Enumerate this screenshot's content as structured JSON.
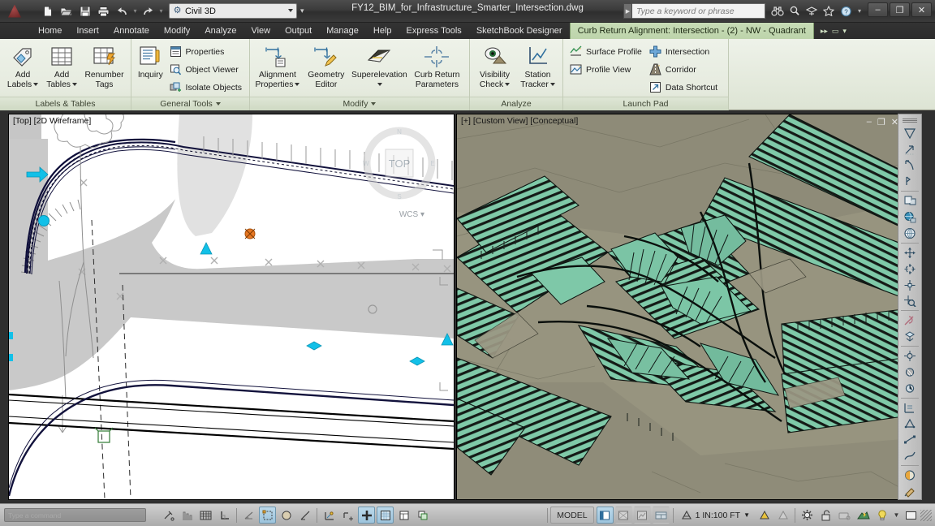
{
  "window": {
    "document_title": "FY12_BIM_for_Infrastructure_Smarter_Intersection.dwg",
    "minimize_label": "–",
    "restore_label": "❐",
    "close_label": "✕"
  },
  "quick_access": {
    "workspace_value": "Civil 3D",
    "items": [
      {
        "name": "new-icon",
        "glyph": "🗋"
      },
      {
        "name": "open-icon",
        "glyph": "📂"
      },
      {
        "name": "save-icon",
        "glyph": "💾"
      },
      {
        "name": "print-icon",
        "glyph": "🖨"
      },
      {
        "name": "undo-icon",
        "glyph": "↶"
      },
      {
        "name": "redo-icon",
        "glyph": "↷"
      }
    ]
  },
  "infocenter": {
    "search_placeholder": "Type a keyword or phrase",
    "icons": [
      {
        "name": "search-binoculars-icon",
        "glyph": "🔭"
      },
      {
        "name": "search-magnifier-icon",
        "glyph": "🔍"
      },
      {
        "name": "subscription-center-icon",
        "glyph": "☂"
      },
      {
        "name": "favorites-star-icon",
        "glyph": "☆"
      },
      {
        "name": "help-icon",
        "glyph": "?"
      }
    ]
  },
  "tabs": {
    "items": [
      "Home",
      "Insert",
      "Annotate",
      "Modify",
      "Analyze",
      "View",
      "Output",
      "Manage",
      "Help",
      "Express Tools",
      "SketchBook Designer"
    ],
    "contextual": "Curb Return Alignment: Intersection - (2) - NW - Quadrant",
    "extras": [
      {
        "name": "ribbon-expand-icon",
        "glyph": "▸▸"
      },
      {
        "name": "ribbon-display-options-icon",
        "glyph": "▭"
      },
      {
        "name": "ribbon-options-caret-icon",
        "glyph": "▾"
      }
    ]
  },
  "ribbon": {
    "panels": [
      {
        "title": "Labels & Tables",
        "has_dropdown": false,
        "big_buttons": [
          {
            "line1": "Add",
            "line2": "Labels",
            "icon": "add-labels-icon",
            "split": true
          },
          {
            "line1": "Add",
            "line2": "Tables",
            "icon": "add-tables-icon",
            "split": true
          },
          {
            "line1": "Renumber",
            "line2": "Tags",
            "icon": "renumber-tags-icon",
            "split": false
          }
        ],
        "small_buttons": []
      },
      {
        "title": "General Tools",
        "has_dropdown": true,
        "big_buttons": [
          {
            "line1": "Inquiry",
            "line2": "",
            "icon": "inquiry-icon",
            "split": false
          }
        ],
        "small_buttons": [
          {
            "label": "Properties",
            "icon": "properties-icon"
          },
          {
            "label": "Object Viewer",
            "icon": "object-viewer-icon"
          },
          {
            "label": "Isolate Objects",
            "icon": "isolate-objects-icon"
          }
        ]
      },
      {
        "title": "Modify",
        "has_dropdown": true,
        "big_buttons": [
          {
            "line1": "Alignment",
            "line2": "Properties",
            "icon": "alignment-properties-icon",
            "split": true
          },
          {
            "line1": "Geometry",
            "line2": "Editor",
            "icon": "geometry-editor-icon",
            "split": false
          },
          {
            "line1": "Superelevation",
            "line2": "",
            "icon": "superelevation-icon",
            "split": true
          },
          {
            "line1": "Curb Return",
            "line2": "Parameters",
            "icon": "curb-return-parameters-icon",
            "split": false
          }
        ],
        "small_buttons": []
      },
      {
        "title": "Analyze",
        "has_dropdown": false,
        "big_buttons": [
          {
            "line1": "Visibility",
            "line2": "Check",
            "icon": "visibility-check-icon",
            "split": true
          },
          {
            "line1": "Station",
            "line2": "Tracker",
            "icon": "station-tracker-icon",
            "split": true
          }
        ],
        "small_buttons": []
      },
      {
        "title": "Launch Pad",
        "has_dropdown": false,
        "big_buttons": [],
        "small_buttons_col1": [
          {
            "label": "Surface Profile",
            "icon": "surface-profile-icon"
          },
          {
            "label": "Profile View",
            "icon": "profile-view-icon"
          }
        ],
        "small_buttons_col2": [
          {
            "label": "Intersection",
            "icon": "intersection-icon"
          },
          {
            "label": "Corridor",
            "icon": "corridor-icon"
          },
          {
            "label": "Data Shortcut",
            "icon": "data-shortcut-icon"
          }
        ]
      }
    ]
  },
  "viewports": {
    "left": {
      "label": "[Top] [2D Wireframe]",
      "ucs_label": "WCS",
      "background": "#ffffff",
      "surface_fill": "#c4c4c4",
      "marker_color": "#12c0e8",
      "point_marker_color": "#e87722"
    },
    "right": {
      "label": "[+] [Custom View] [Conceptual]",
      "background": "#8b8a77",
      "corridor_color": "#73c6a6",
      "terrain_color": "#97947f",
      "controls": [
        {
          "name": "viewport-minimize-icon",
          "glyph": "–"
        },
        {
          "name": "viewport-maximize-icon",
          "glyph": "❐"
        },
        {
          "name": "viewport-close-icon",
          "glyph": "✕"
        }
      ]
    }
  },
  "navbar": {
    "icons": [
      {
        "name": "steering-wheel-icon",
        "glyph": "⬟"
      },
      {
        "name": "pan-icon",
        "glyph": "✥"
      },
      {
        "name": "zoom-extents-icon",
        "glyph": "⌕"
      },
      {
        "name": "orbit-icon",
        "glyph": "↻"
      },
      {
        "name": "show-motion-icon",
        "glyph": "▶"
      },
      {
        "name": "geographic-location-icon",
        "glyph": "🌐"
      },
      {
        "name": "view-globe-icon",
        "glyph": "◔"
      },
      {
        "name": "move-gizmo-icon",
        "glyph": "✣"
      },
      {
        "name": "rotate-gizmo-icon",
        "glyph": "✦"
      },
      {
        "name": "scale-gizmo-icon",
        "glyph": "✧"
      },
      {
        "name": "magnifier-icon",
        "glyph": "🔍"
      },
      {
        "name": "measure-icon",
        "glyph": "↗"
      },
      {
        "name": "section-plane-icon",
        "glyph": "◱"
      },
      {
        "name": "object-snap-icon",
        "glyph": "⊙"
      },
      {
        "name": "transparency-icon",
        "glyph": "▦"
      },
      {
        "name": "rotate-view-icon",
        "glyph": "↺"
      },
      {
        "name": "add-point-icon",
        "glyph": "⊕"
      },
      {
        "name": "array-icon",
        "glyph": "⊞"
      },
      {
        "name": "dimension-icon",
        "glyph": "⊥"
      },
      {
        "name": "align-icon",
        "glyph": "⨍"
      },
      {
        "name": "spline-icon",
        "glyph": "∿"
      },
      {
        "name": "curve-icon",
        "glyph": "⌒"
      },
      {
        "name": "render-icon",
        "glyph": "◑"
      },
      {
        "name": "material-icon",
        "glyph": "◕"
      }
    ]
  },
  "command_line": {
    "text": "Type a command"
  },
  "statusbar": {
    "left_toggles": [
      {
        "name": "snap-mode-toggle",
        "glyph": "⋅⋅",
        "state": "on"
      },
      {
        "name": "grid-display-toggle",
        "glyph": "⌗",
        "state": "off"
      },
      {
        "name": "grid-mode-toggle",
        "glyph": "▦",
        "state": "off"
      },
      {
        "name": "ortho-mode-toggle",
        "glyph": "∟",
        "state": "off"
      },
      {
        "name": "polar-tracking-toggle",
        "glyph": "∡",
        "state": "off"
      },
      {
        "name": "object-snap-toggle",
        "glyph": "◱",
        "state": "on"
      },
      {
        "name": "3d-object-snap-toggle",
        "glyph": "◍",
        "state": "off"
      },
      {
        "name": "object-snap-tracking-toggle",
        "glyph": "∠",
        "state": "off"
      },
      {
        "name": "dynamic-ucs-toggle",
        "glyph": "⊿",
        "state": "off"
      },
      {
        "name": "dynamic-input-toggle",
        "glyph": "+",
        "state": "off"
      },
      {
        "name": "lineweight-toggle",
        "glyph": "➕",
        "state": "on"
      },
      {
        "name": "transparency-toggle",
        "glyph": "▒",
        "state": "on"
      },
      {
        "name": "quick-properties-toggle",
        "glyph": "▤",
        "state": "off"
      },
      {
        "name": "selection-cycling-toggle",
        "glyph": "⧉",
        "state": "off"
      }
    ],
    "model_label": "MODEL",
    "layout_buttons": [
      {
        "name": "model-space-button",
        "glyph": "◰",
        "state": "on"
      },
      {
        "name": "quick-view-layouts-button",
        "glyph": "▧",
        "state": "off"
      },
      {
        "name": "quick-view-drawings-button",
        "glyph": "▨",
        "state": "off"
      },
      {
        "name": "pan-zoom-button",
        "glyph": "▥",
        "state": "off"
      }
    ],
    "annotation_scale": "1 IN:100 FT",
    "scale_icons": [
      {
        "name": "annotation-visibility-icon",
        "glyph": "△"
      },
      {
        "name": "auto-scale-icon",
        "glyph": "△"
      }
    ],
    "right_icons": [
      {
        "name": "workspace-switching-icon",
        "glyph": "⚙"
      },
      {
        "name": "toolbar-lock-icon",
        "glyph": "🔓"
      },
      {
        "name": "hardware-acceleration-icon",
        "glyph": "▭"
      },
      {
        "name": "isolate-objects-icon",
        "glyph": "◳"
      },
      {
        "name": "status-bar-bulb-icon",
        "glyph": "💡"
      },
      {
        "name": "status-menu-caret-icon",
        "glyph": "▾"
      },
      {
        "name": "clean-screen-icon",
        "glyph": "▭"
      },
      {
        "name": "resize-grip-icon",
        "glyph": "⋰"
      }
    ]
  }
}
